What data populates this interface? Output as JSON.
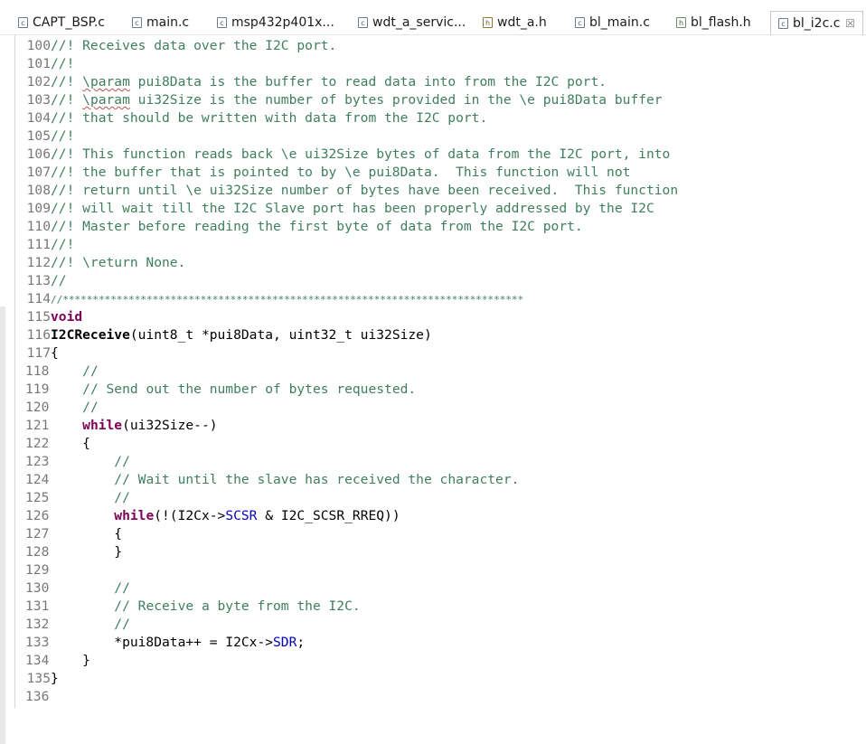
{
  "tabs": [
    {
      "label": "CAPT_BSP.c",
      "icon": "c-file-icon"
    },
    {
      "label": "main.c",
      "icon": "c-file-icon"
    },
    {
      "label": "msp432p401x...",
      "icon": "c-file-icon"
    },
    {
      "label": "wdt_a_servic...",
      "icon": "c-file-icon"
    },
    {
      "label": "wdt_a.h",
      "icon": "h-file-icon"
    },
    {
      "label": "bl_main.c",
      "icon": "c-file-icon"
    },
    {
      "label": "bl_flash.h",
      "icon": "h-file-icon"
    },
    {
      "label": "bl_i2c.c",
      "icon": "c-file-icon",
      "active": true
    }
  ],
  "close_glyph": "☒",
  "lines": [
    {
      "n": "100",
      "parts": [
        [
          "cm",
          "//! Receives data over the I2C port."
        ]
      ]
    },
    {
      "n": "101",
      "parts": [
        [
          "cm",
          "//!"
        ]
      ]
    },
    {
      "n": "102",
      "parts": [
        [
          "cm",
          "//! "
        ],
        [
          "cmsq",
          "\\param"
        ],
        [
          "cm",
          " pui8Data is the buffer to read data into from the I2C port."
        ]
      ]
    },
    {
      "n": "103",
      "parts": [
        [
          "cm",
          "//! "
        ],
        [
          "cmsq",
          "\\param"
        ],
        [
          "cm",
          " ui32Size is the number of bytes provided in the \\e pui8Data buffer"
        ]
      ]
    },
    {
      "n": "104",
      "parts": [
        [
          "cm",
          "//! that should be written with data from the I2C port."
        ]
      ]
    },
    {
      "n": "105",
      "parts": [
        [
          "cm",
          "//!"
        ]
      ]
    },
    {
      "n": "106",
      "parts": [
        [
          "cm",
          "//! This function reads back \\e ui32Size bytes of data from the I2C port, into"
        ]
      ]
    },
    {
      "n": "107",
      "parts": [
        [
          "cm",
          "//! the buffer that is pointed to by \\e pui8Data.  This function will not"
        ]
      ]
    },
    {
      "n": "108",
      "parts": [
        [
          "cm",
          "//! return until \\e ui32Size number of bytes have been received.  This function"
        ]
      ]
    },
    {
      "n": "109",
      "parts": [
        [
          "cm",
          "//! will wait till the I2C Slave port has been properly addressed by the I2C"
        ]
      ]
    },
    {
      "n": "110",
      "parts": [
        [
          "cm",
          "//! Master before reading the first byte of data from the I2C port."
        ]
      ]
    },
    {
      "n": "111",
      "parts": [
        [
          "cm",
          "//!"
        ]
      ]
    },
    {
      "n": "112",
      "parts": [
        [
          "cm",
          "//! \\return None."
        ]
      ]
    },
    {
      "n": "113",
      "parts": [
        [
          "cm",
          "//"
        ]
      ]
    },
    {
      "n": "114",
      "parts": [
        [
          "cm",
          "//*****************************************************************************"
        ]
      ],
      "small": true
    },
    {
      "n": "115",
      "parts": [
        [
          "kw",
          "void"
        ]
      ]
    },
    {
      "n": "116",
      "parts": [
        [
          "fn",
          "I2CReceive"
        ],
        [
          "tx",
          "(uint8_t *pui8Data, uint32_t ui32Size)"
        ]
      ]
    },
    {
      "n": "117",
      "parts": [
        [
          "tx",
          "{"
        ]
      ]
    },
    {
      "n": "118",
      "body": true,
      "parts": [
        [
          "tx",
          "    "
        ],
        [
          "cm",
          "//"
        ]
      ]
    },
    {
      "n": "119",
      "body": true,
      "parts": [
        [
          "tx",
          "    "
        ],
        [
          "cm",
          "// Send out the number of bytes requested."
        ]
      ]
    },
    {
      "n": "120",
      "body": true,
      "parts": [
        [
          "tx",
          "    "
        ],
        [
          "cm",
          "//"
        ]
      ]
    },
    {
      "n": "121",
      "body": true,
      "parts": [
        [
          "tx",
          "    "
        ],
        [
          "kw",
          "while"
        ],
        [
          "tx",
          "(ui32Size--)"
        ]
      ]
    },
    {
      "n": "122",
      "body": true,
      "parts": [
        [
          "tx",
          "    {"
        ]
      ]
    },
    {
      "n": "123",
      "body": true,
      "parts": [
        [
          "tx",
          "        "
        ],
        [
          "cm",
          "//"
        ]
      ]
    },
    {
      "n": "124",
      "body": true,
      "parts": [
        [
          "tx",
          "        "
        ],
        [
          "cm",
          "// Wait until the slave has received the character."
        ]
      ]
    },
    {
      "n": "125",
      "body": true,
      "parts": [
        [
          "tx",
          "        "
        ],
        [
          "cm",
          "//"
        ]
      ]
    },
    {
      "n": "126",
      "body": true,
      "parts": [
        [
          "tx",
          "        "
        ],
        [
          "kw",
          "while"
        ],
        [
          "tx",
          "(!(I2Cx->"
        ],
        [
          "fld",
          "SCSR"
        ],
        [
          "tx",
          " & I2C_SCSR_RREQ))"
        ]
      ]
    },
    {
      "n": "127",
      "body": true,
      "parts": [
        [
          "tx",
          "        {"
        ]
      ]
    },
    {
      "n": "128",
      "body": true,
      "parts": [
        [
          "tx",
          "        }"
        ]
      ]
    },
    {
      "n": "129",
      "body": true,
      "parts": [
        [
          "tx",
          ""
        ]
      ]
    },
    {
      "n": "130",
      "body": true,
      "parts": [
        [
          "tx",
          "        "
        ],
        [
          "cm",
          "//"
        ]
      ]
    },
    {
      "n": "131",
      "body": true,
      "parts": [
        [
          "tx",
          "        "
        ],
        [
          "cm",
          "// Receive a byte from the I2C."
        ]
      ]
    },
    {
      "n": "132",
      "body": true,
      "parts": [
        [
          "tx",
          "        "
        ],
        [
          "cm",
          "//"
        ]
      ]
    },
    {
      "n": "133",
      "body": true,
      "parts": [
        [
          "tx",
          "        *pui8Data++ = I2Cx->"
        ],
        [
          "fld",
          "SDR"
        ],
        [
          "tx",
          ";"
        ]
      ]
    },
    {
      "n": "134",
      "body": true,
      "parts": [
        [
          "tx",
          "    }"
        ]
      ]
    },
    {
      "n": "135",
      "parts": [
        [
          "tx",
          "}"
        ]
      ]
    },
    {
      "n": "136",
      "body": true,
      "parts": [
        [
          "tx",
          ""
        ]
      ]
    }
  ]
}
